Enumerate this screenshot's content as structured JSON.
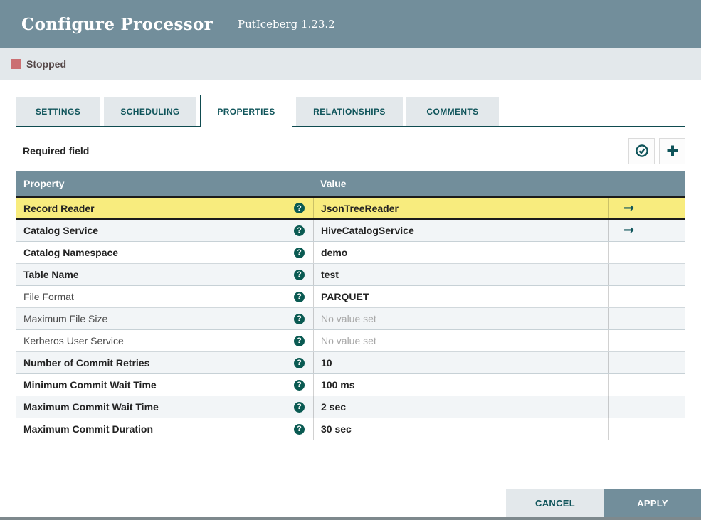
{
  "dialog": {
    "title": "Configure Processor",
    "subtitle": "PutIceberg 1.23.2"
  },
  "status": {
    "label": "Stopped"
  },
  "tabs": [
    {
      "label": "SETTINGS",
      "active": false
    },
    {
      "label": "SCHEDULING",
      "active": false
    },
    {
      "label": "PROPERTIES",
      "active": true
    },
    {
      "label": "RELATIONSHIPS",
      "active": false
    },
    {
      "label": "COMMENTS",
      "active": false
    }
  ],
  "properties_panel": {
    "required_hint": "Required field",
    "verify_icon": "check-circle-icon",
    "add_icon": "plus-icon"
  },
  "table": {
    "columns": {
      "property": "Property",
      "value": "Value"
    },
    "help_glyph": "?",
    "goto_glyph": "→",
    "rows": [
      {
        "property": "Record Reader",
        "value": "JsonTreeReader",
        "required": true,
        "unset": false,
        "goto": true,
        "selected": true
      },
      {
        "property": "Catalog Service",
        "value": "HiveCatalogService",
        "required": true,
        "unset": false,
        "goto": true,
        "selected": false
      },
      {
        "property": "Catalog Namespace",
        "value": "demo",
        "required": true,
        "unset": false,
        "goto": false,
        "selected": false
      },
      {
        "property": "Table Name",
        "value": "test",
        "required": true,
        "unset": false,
        "goto": false,
        "selected": false
      },
      {
        "property": "File Format",
        "value": "PARQUET",
        "required": false,
        "unset": false,
        "goto": false,
        "selected": false
      },
      {
        "property": "Maximum File Size",
        "value": "No value set",
        "required": false,
        "unset": true,
        "goto": false,
        "selected": false
      },
      {
        "property": "Kerberos User Service",
        "value": "No value set",
        "required": false,
        "unset": true,
        "goto": false,
        "selected": false
      },
      {
        "property": "Number of Commit Retries",
        "value": "10",
        "required": true,
        "unset": false,
        "goto": false,
        "selected": false
      },
      {
        "property": "Minimum Commit Wait Time",
        "value": "100 ms",
        "required": true,
        "unset": false,
        "goto": false,
        "selected": false
      },
      {
        "property": "Maximum Commit Wait Time",
        "value": "2 sec",
        "required": true,
        "unset": false,
        "goto": false,
        "selected": false
      },
      {
        "property": "Maximum Commit Duration",
        "value": "30 sec",
        "required": true,
        "unset": false,
        "goto": false,
        "selected": false
      }
    ]
  },
  "footer": {
    "cancel": "CANCEL",
    "apply": "APPLY"
  },
  "colors": {
    "header_bg": "#728E9B",
    "panel_gray": "#E3E8EB",
    "accent_teal": "#0F545A",
    "stopped_red": "#CB6F72",
    "selected_row_yellow": "#F8EC7E",
    "alt_row": "#F2F5F7"
  }
}
